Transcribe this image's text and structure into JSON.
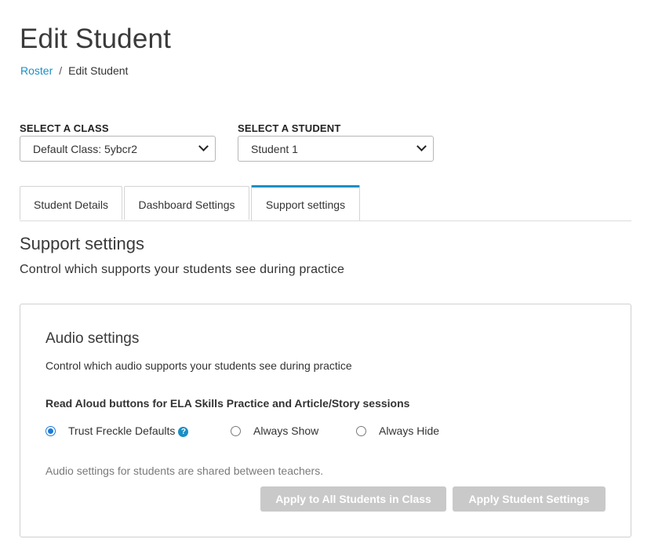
{
  "page": {
    "title": "Edit Student"
  },
  "breadcrumb": {
    "link": "Roster",
    "separator": "/",
    "current": "Edit Student"
  },
  "class_select": {
    "label": "SELECT A CLASS",
    "value": "Default Class: 5ybcr2"
  },
  "student_select": {
    "label": "SELECT A STUDENT",
    "value": "Student 1"
  },
  "tabs": [
    {
      "label": "Student Details",
      "active": false
    },
    {
      "label": "Dashboard Settings",
      "active": false
    },
    {
      "label": "Support settings",
      "active": true
    }
  ],
  "section": {
    "title": "Support settings",
    "subtitle": "Control which supports your students see during practice"
  },
  "audio": {
    "title": "Audio settings",
    "subtitle": "Control which audio supports your students see during practice",
    "question": "Read Aloud buttons for ELA Skills Practice and Article/Story sessions",
    "options": [
      {
        "label": "Trust Freckle Defaults",
        "checked": true,
        "help_icon": "question-circle"
      },
      {
        "label": "Always Show",
        "checked": false
      },
      {
        "label": "Always Hide",
        "checked": false
      }
    ],
    "help_glyph": "?",
    "note": "Audio settings for students are shared between teachers.",
    "apply_all_label": "Apply to All Students in Class",
    "apply_student_label": "Apply Student Settings"
  },
  "colors": {
    "accent": "#1a8fc4",
    "radio": "#1a7bd8",
    "disabled_button": "#c9c9c9"
  }
}
